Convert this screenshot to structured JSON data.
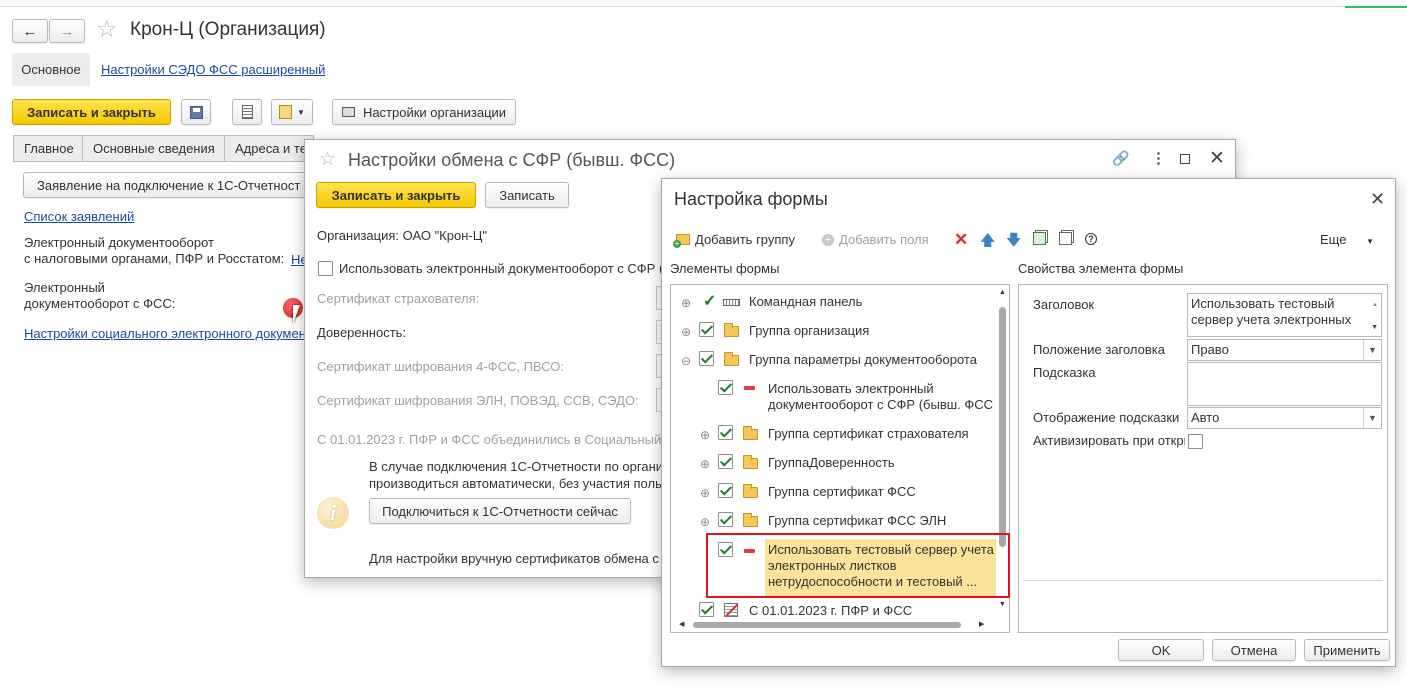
{
  "main": {
    "title": "Крон-Ц (Организация)",
    "nav_tabs": [
      "Основное",
      "Настройки СЭДО ФСС расширенный"
    ],
    "save_close": "Записать и закрыть",
    "org_settings": "Настройки организации",
    "tabs": [
      "Главное",
      "Основные сведения",
      "Адреса и те"
    ],
    "request_button": "Заявление на подключение к 1С-Отчетност",
    "requests_link": "Список заявлений",
    "edo_label_line1": "Электронный документооборот",
    "edo_label_line2": "с налоговыми органами, ПФР и Росстатом:",
    "edo_link": "Не",
    "fss_label_line1": "Электронный",
    "fss_label_line2": "документооборот с ФСС:",
    "social_link": "Настройки социального электронного докумен"
  },
  "exchange": {
    "title": "Настройки обмена с СФР (бывш. ФСС)",
    "save_close": "Записать и закрыть",
    "save": "Записать",
    "organization": "Организация: ОАО \"Крон-Ц\"",
    "use_edo": "Использовать электронный документооборот с СФР (",
    "cert_insurer": "Сертификат страхователя:",
    "trust": "Доверенность:",
    "cert_4fss": "Сертификат шифрования 4-ФСС, ПВСО:",
    "cert_eln": "Сертификат шифрования ЭЛН, ПОВЭД, ССВ, СЭДО:",
    "merged": "С 01.01.2023 г. ПФР и ФСС объединились в Социальный",
    "info_line1": "В случае подключения 1С-Отчетности по органи",
    "info_line2": "производиться автоматически, без участия поль",
    "connect_button": "Подключиться к 1С-Отчетности сейчас",
    "manual": "Для настройки вручную сертификатов обмена с"
  },
  "form_settings": {
    "title": "Настройка формы",
    "toolbar": {
      "add_group": "Добавить группу",
      "add_fields": "Добавить поля",
      "more": "Еще"
    },
    "elements_header": "Элементы формы",
    "properties_header": "Свойства элемента формы",
    "tree": [
      {
        "label": "Командная панель"
      },
      {
        "label": "Группа организация"
      },
      {
        "label": "Группа параметры документооборота"
      },
      {
        "label_line1": "Использовать электронный",
        "label_line2": "документооборот с СФР (бывш. ФСС"
      },
      {
        "label": "Группа сертификат страхователя"
      },
      {
        "label": "ГруппаДоверенность"
      },
      {
        "label": "Группа сертификат ФСС"
      },
      {
        "label": "Группа сертификат ФСС ЭЛН"
      },
      {
        "label_line1": "Использовать тестовый сервер учета",
        "label_line2": "электронных листков",
        "label_line3": "нетрудоспособности и тестовый ..."
      },
      {
        "label": "С 01.01.2023 г. ПФР и ФСС"
      }
    ],
    "props": {
      "title_label": "Заголовок",
      "title_value_line1": "Использовать тестовый",
      "title_value_line2": "сервер учета электронных",
      "position_label": "Положение заголовка",
      "position_value": "Право",
      "hint_label": "Подсказка",
      "hint_display_label": "Отображение подсказки",
      "hint_display_value": "Авто",
      "activate_label": "Активизировать при откры"
    },
    "ok": "OK",
    "cancel": "Отмена",
    "apply": "Применить"
  },
  "colors": {
    "accent_yellow": "#f5c800",
    "highlight": "#fbe49a",
    "red_frame": "#e0141e",
    "link": "#1a4a9c"
  }
}
